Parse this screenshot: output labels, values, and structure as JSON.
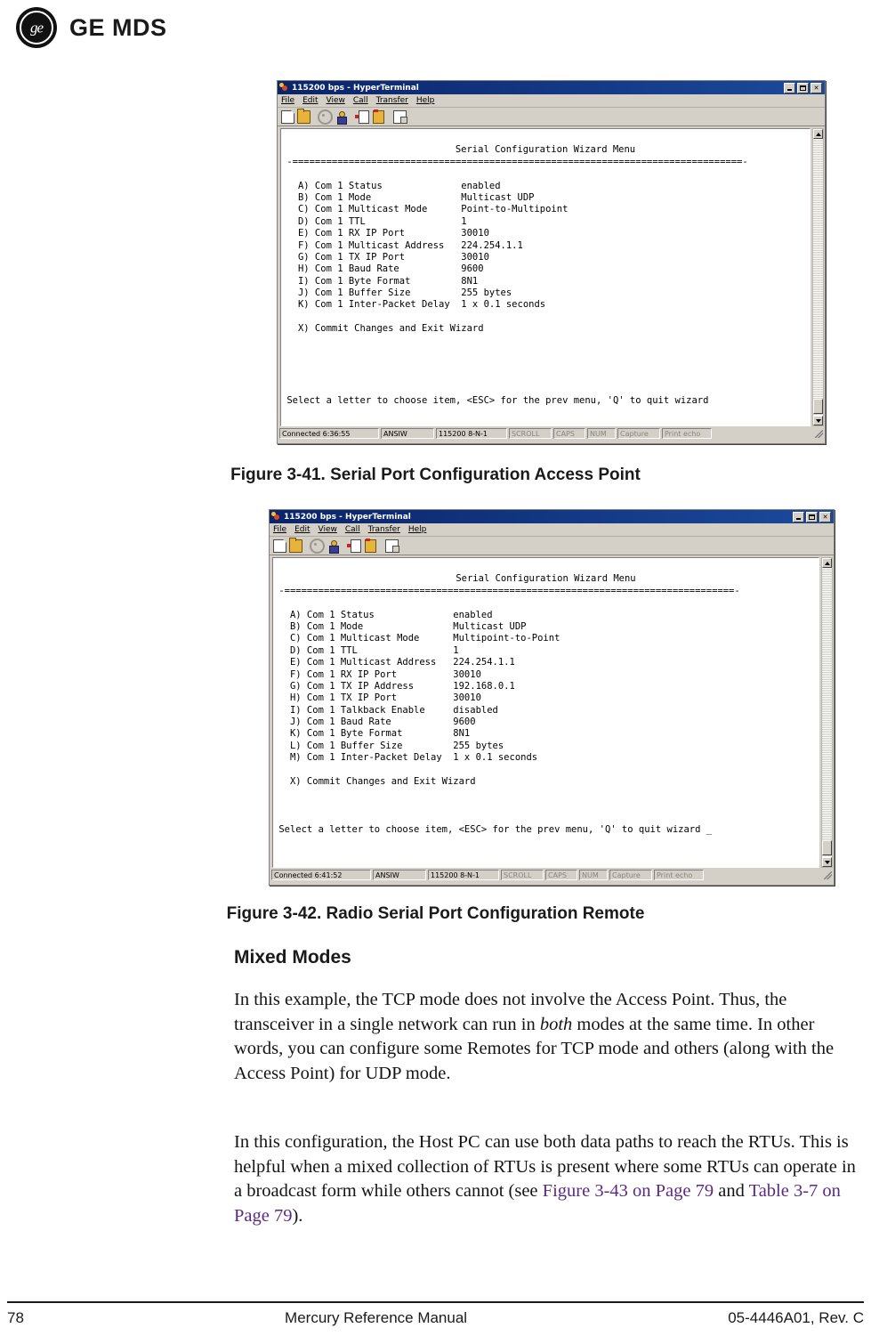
{
  "header": {
    "logo_mark": "ge-monogram",
    "logo_letters": "ge",
    "brand": "GE MDS"
  },
  "terminal_one": {
    "title": "115200 bps - HyperTerminal",
    "menus": [
      "File",
      "Edit",
      "View",
      "Call",
      "Transfer",
      "Help"
    ],
    "toolbar": [
      "new-icon",
      "open-icon",
      "call-icon",
      "disconnect-icon",
      "send-file-icon",
      "receive-file-icon",
      "properties-icon"
    ],
    "screen": {
      "heading": "Serial Configuration Wizard Menu",
      "rule": "-================================================================================-",
      "items": [
        {
          "key": "A)",
          "label": "Com 1 Status",
          "value": "enabled"
        },
        {
          "key": "B)",
          "label": "Com 1 Mode",
          "value": "Multicast UDP"
        },
        {
          "key": "C)",
          "label": "Com 1 Multicast Mode",
          "value": "Point-to-Multipoint"
        },
        {
          "key": "D)",
          "label": "Com 1 TTL",
          "value": "1"
        },
        {
          "key": "E)",
          "label": "Com 1 RX IP Port",
          "value": "30010"
        },
        {
          "key": "F)",
          "label": "Com 1 Multicast Address",
          "value": "224.254.1.1"
        },
        {
          "key": "G)",
          "label": "Com 1 TX IP Port",
          "value": "30010"
        },
        {
          "key": "H)",
          "label": "Com 1 Baud Rate",
          "value": "9600"
        },
        {
          "key": "I)",
          "label": "Com 1 Byte Format",
          "value": "8N1"
        },
        {
          "key": "J)",
          "label": "Com 1 Buffer Size",
          "value": "255 bytes"
        },
        {
          "key": "K)",
          "label": "Com 1 Inter-Packet Delay",
          "value": "1 x 0.1 seconds"
        }
      ],
      "commit": "X) Commit Changes and Exit Wizard",
      "prompt": "Select a letter to choose item, <ESC> for the prev menu, 'Q' to quit wizard"
    },
    "status": {
      "connected": "Connected 6:36:55",
      "emulation": "ANSIW",
      "line": "115200 8-N-1",
      "scroll": "SCROLL",
      "caps": "CAPS",
      "num": "NUM",
      "capture": "Capture",
      "print_echo": "Print echo"
    }
  },
  "figure_41_caption": "Figure 3-41. Serial Port Configuration   Access Point",
  "terminal_two": {
    "title": "115200 bps - HyperTerminal",
    "menus": [
      "File",
      "Edit",
      "View",
      "Call",
      "Transfer",
      "Help"
    ],
    "toolbar": [
      "new-icon",
      "open-icon",
      "call-icon",
      "disconnect-icon",
      "send-file-icon",
      "receive-file-icon",
      "properties-icon"
    ],
    "screen": {
      "heading": "Serial Configuration Wizard Menu",
      "rule": "-================================================================================-",
      "items": [
        {
          "key": "A)",
          "label": "Com 1 Status",
          "value": "enabled"
        },
        {
          "key": "B)",
          "label": "Com 1 Mode",
          "value": "Multicast UDP"
        },
        {
          "key": "C)",
          "label": "Com 1 Multicast Mode",
          "value": "Multipoint-to-Point"
        },
        {
          "key": "D)",
          "label": "Com 1 TTL",
          "value": "1"
        },
        {
          "key": "E)",
          "label": "Com 1 Multicast Address",
          "value": "224.254.1.1"
        },
        {
          "key": "F)",
          "label": "Com 1 RX IP Port",
          "value": "30010"
        },
        {
          "key": "G)",
          "label": "Com 1 TX IP Address",
          "value": "192.168.0.1"
        },
        {
          "key": "H)",
          "label": "Com 1 TX IP Port",
          "value": "30010"
        },
        {
          "key": "I)",
          "label": "Com 1 Talkback Enable",
          "value": "disabled"
        },
        {
          "key": "J)",
          "label": "Com 1 Baud Rate",
          "value": "9600"
        },
        {
          "key": "K)",
          "label": "Com 1 Byte Format",
          "value": "8N1"
        },
        {
          "key": "L)",
          "label": "Com 1 Buffer Size",
          "value": "255 bytes"
        },
        {
          "key": "M)",
          "label": "Com 1 Inter-Packet Delay",
          "value": "1 x 0.1 seconds"
        }
      ],
      "commit": "X) Commit Changes and Exit Wizard",
      "prompt": "Select a letter to choose item, <ESC> for the prev menu, 'Q' to quit wizard _"
    },
    "status": {
      "connected": "Connected 6:41:52",
      "emulation": "ANSIW",
      "line": "115200 8-N-1",
      "scroll": "SCROLL",
      "caps": "CAPS",
      "num": "NUM",
      "capture": "Capture",
      "print_echo": "Print echo"
    }
  },
  "figure_42_caption": "Figure 3-42. Radio Serial Port Configuration   Remote",
  "section": {
    "heading": "Mixed Modes",
    "para1_a": "In this example, the TCP mode does not involve the Access Point. Thus, the transceiver in a single network can run in ",
    "para1_italic": "both",
    "para1_b": " modes at the same time. In other words, you can configure some Remotes for TCP mode and others (along with the Access Point) for UDP mode.",
    "para2_a": "In this configuration, the Host PC can use both data paths to reach the RTUs. This is helpful when a mixed collection of RTUs is present where some RTUs can operate in a broadcast form while others cannot (see ",
    "para2_xref1": "Figure 3-43 on Page 79",
    "para2_mid": " and ",
    "para2_xref2": "Table 3-7 on Page 79",
    "para2_b": ")."
  },
  "colors": {
    "xref": "#5b2a83",
    "titlebar": "#0a246a",
    "window_face": "#d4d0c8"
  },
  "footer": {
    "page_number": "78",
    "manual_title": "Mercury Reference Manual",
    "doc_id": "05-4446A01, Rev. C"
  }
}
